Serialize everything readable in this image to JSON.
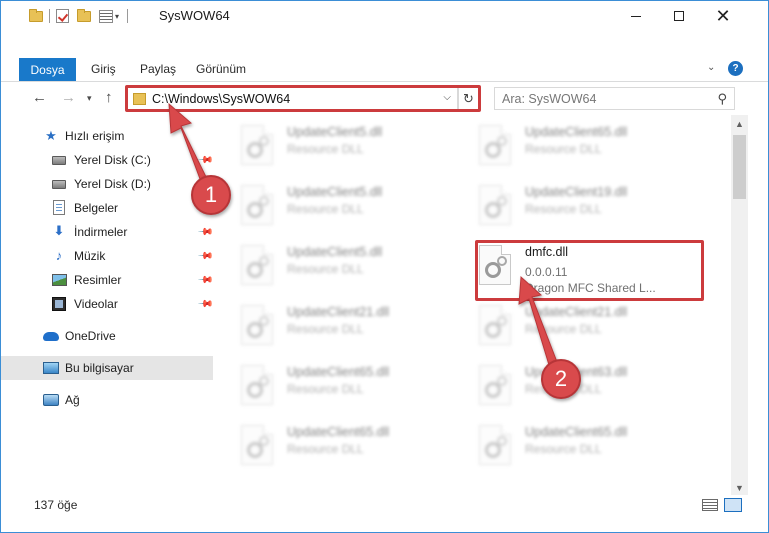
{
  "window": {
    "title": "SysWOW64"
  },
  "ribbon": {
    "tabs": [
      "Dosya",
      "Giriş",
      "Paylaş",
      "Görünüm"
    ],
    "help_label": "?"
  },
  "address": {
    "path": "C:\\Windows\\SysWOW64"
  },
  "search": {
    "placeholder": "Ara: SysWOW64"
  },
  "sidebar": {
    "items": [
      {
        "label": "Hızlı erişim",
        "icon": "star-icon"
      },
      {
        "label": "Yerel Disk (C:)",
        "icon": "drive-icon"
      },
      {
        "label": "Yerel Disk (D:)",
        "icon": "drive-icon"
      },
      {
        "label": "Belgeler",
        "icon": "documents-icon"
      },
      {
        "label": "İndirmeler",
        "icon": "download-icon"
      },
      {
        "label": "Müzik",
        "icon": "music-icon"
      },
      {
        "label": "Resimler",
        "icon": "pictures-icon"
      },
      {
        "label": "Videolar",
        "icon": "videos-icon"
      },
      {
        "label": "OneDrive",
        "icon": "cloud-icon"
      },
      {
        "label": "Bu bilgisayar",
        "icon": "computer-icon"
      },
      {
        "label": "Ağ",
        "icon": "network-icon"
      }
    ]
  },
  "files": [
    {
      "name": "UpdateClient5.dll",
      "sub": "Resource DLL"
    },
    {
      "name": "UpdateClient65.dll",
      "sub": "Resource DLL"
    },
    {
      "name": "UpdateClient5.dll",
      "sub": "Resource DLL"
    },
    {
      "name": "UpdateClient19.dll",
      "sub": "Resource DLL"
    },
    {
      "name": "UpdateClient5.dll",
      "sub": "Resource DLL"
    },
    {
      "name": "dmfc.dll",
      "sub": "0.0.0.11",
      "sub2": "Dragon MFC Shared L..."
    },
    {
      "name": "UpdateClient21.dll",
      "sub": "Resource DLL"
    },
    {
      "name": "UpdateClient21.dll",
      "sub": "Resource DLL"
    },
    {
      "name": "UpdateClient65.dll",
      "sub": "Resource DLL"
    },
    {
      "name": "UpdateClient63.dll",
      "sub": "Resource DLL"
    },
    {
      "name": "UpdateClient65.dll",
      "sub": "Resource DLL"
    },
    {
      "name": "UpdateClient65.dll",
      "sub": "Resource DLL"
    }
  ],
  "status": {
    "count": "137 öğe"
  },
  "annotations": {
    "step1": "1",
    "step2": "2",
    "color": "#d94a4c"
  }
}
